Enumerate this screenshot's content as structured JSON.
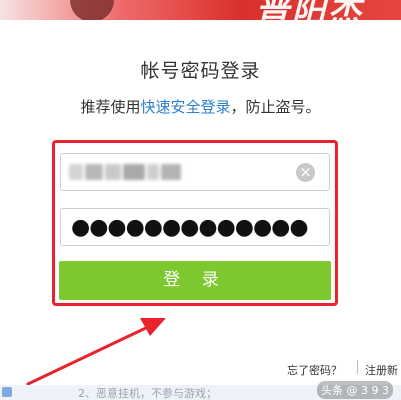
{
  "banner": {
    "brush_text": "晋阳杰"
  },
  "login": {
    "title": "帐号密码登录",
    "subtitle_prefix": "推荐使用",
    "subtitle_link": "快速安全登录",
    "subtitle_suffix": "，防止盗号。",
    "password_value": "●●●●●●●●●●●●●",
    "submit_label": "登 录",
    "forgot_label": "忘了密码？",
    "register_label": "注册新"
  },
  "footer": {
    "tip": "2、恶意挂机，不参与游戏；",
    "watermark": "头条 @ 3 9 3"
  },
  "colors": {
    "highlight_box": "#e8232d",
    "submit_button": "#7dc72f",
    "link": "#2a7fd0"
  },
  "icons": {
    "clear": "clear-circle-icon",
    "arrow": "red-arrow-annotation"
  }
}
